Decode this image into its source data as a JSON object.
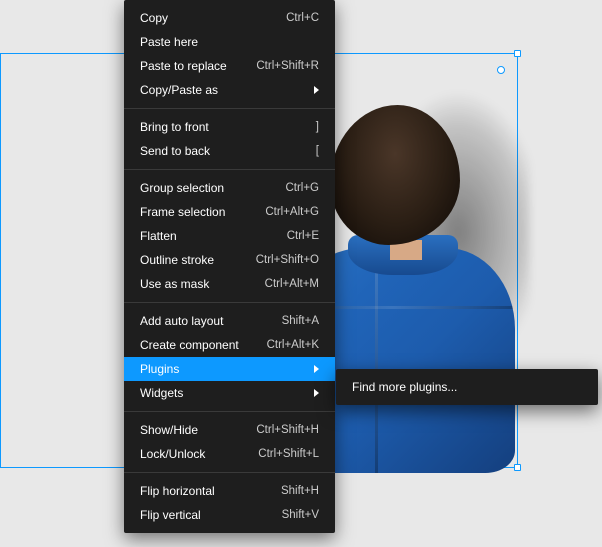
{
  "menu": {
    "groups": [
      [
        {
          "label": "Copy",
          "shortcut": "Ctrl+C"
        },
        {
          "label": "Paste here",
          "shortcut": ""
        },
        {
          "label": "Paste to replace",
          "shortcut": "Ctrl+Shift+R"
        },
        {
          "label": "Copy/Paste as",
          "submenu": true
        }
      ],
      [
        {
          "label": "Bring to front",
          "shortcut": "]"
        },
        {
          "label": "Send to back",
          "shortcut": "["
        }
      ],
      [
        {
          "label": "Group selection",
          "shortcut": "Ctrl+G"
        },
        {
          "label": "Frame selection",
          "shortcut": "Ctrl+Alt+G"
        },
        {
          "label": "Flatten",
          "shortcut": "Ctrl+E"
        },
        {
          "label": "Outline stroke",
          "shortcut": "Ctrl+Shift+O"
        },
        {
          "label": "Use as mask",
          "shortcut": "Ctrl+Alt+M"
        }
      ],
      [
        {
          "label": "Add auto layout",
          "shortcut": "Shift+A"
        },
        {
          "label": "Create component",
          "shortcut": "Ctrl+Alt+K"
        },
        {
          "label": "Plugins",
          "submenu": true,
          "highlight": true
        },
        {
          "label": "Widgets",
          "submenu": true
        }
      ],
      [
        {
          "label": "Show/Hide",
          "shortcut": "Ctrl+Shift+H"
        },
        {
          "label": "Lock/Unlock",
          "shortcut": "Ctrl+Shift+L"
        }
      ],
      [
        {
          "label": "Flip horizontal",
          "shortcut": "Shift+H"
        },
        {
          "label": "Flip vertical",
          "shortcut": "Shift+V"
        }
      ]
    ]
  },
  "submenu": {
    "items": [
      {
        "label": "Find more plugins..."
      }
    ]
  }
}
